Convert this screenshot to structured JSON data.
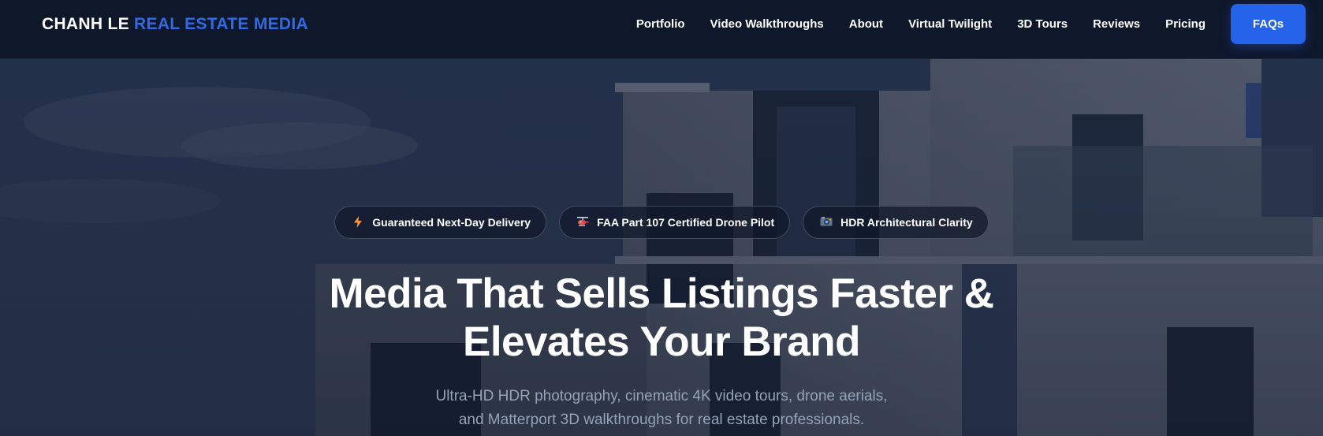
{
  "brand": {
    "name_primary": "CHANH LE",
    "name_accent": "REAL ESTATE MEDIA"
  },
  "nav": {
    "links": [
      "Portfolio",
      "Video Walkthroughs",
      "About",
      "Virtual Twilight",
      "3D Tours",
      "Reviews",
      "Pricing"
    ],
    "cta_label": "FAQs"
  },
  "hero": {
    "badges": [
      {
        "icon": "lightning-bolt-icon",
        "label": "Guaranteed Next-Day Delivery"
      },
      {
        "icon": "helicopter-drone-icon",
        "label": "FAA Part 107 Certified Drone Pilot"
      },
      {
        "icon": "camera-icon",
        "label": "HDR Architectural Clarity"
      }
    ],
    "headline_line1": "Media That Sells Listings Faster &",
    "headline_line2": "Elevates Your Brand",
    "subhead_line1": "Ultra-HD HDR photography, cinematic 4K video tours, drone aerials,",
    "subhead_line2": "and Matterport 3D walkthroughs for real estate professionals."
  },
  "colors": {
    "nav_bg": "#0f172a",
    "accent": "#2563eb",
    "brand_accent": "#2f6be6",
    "subhead": "#94a3b8"
  }
}
